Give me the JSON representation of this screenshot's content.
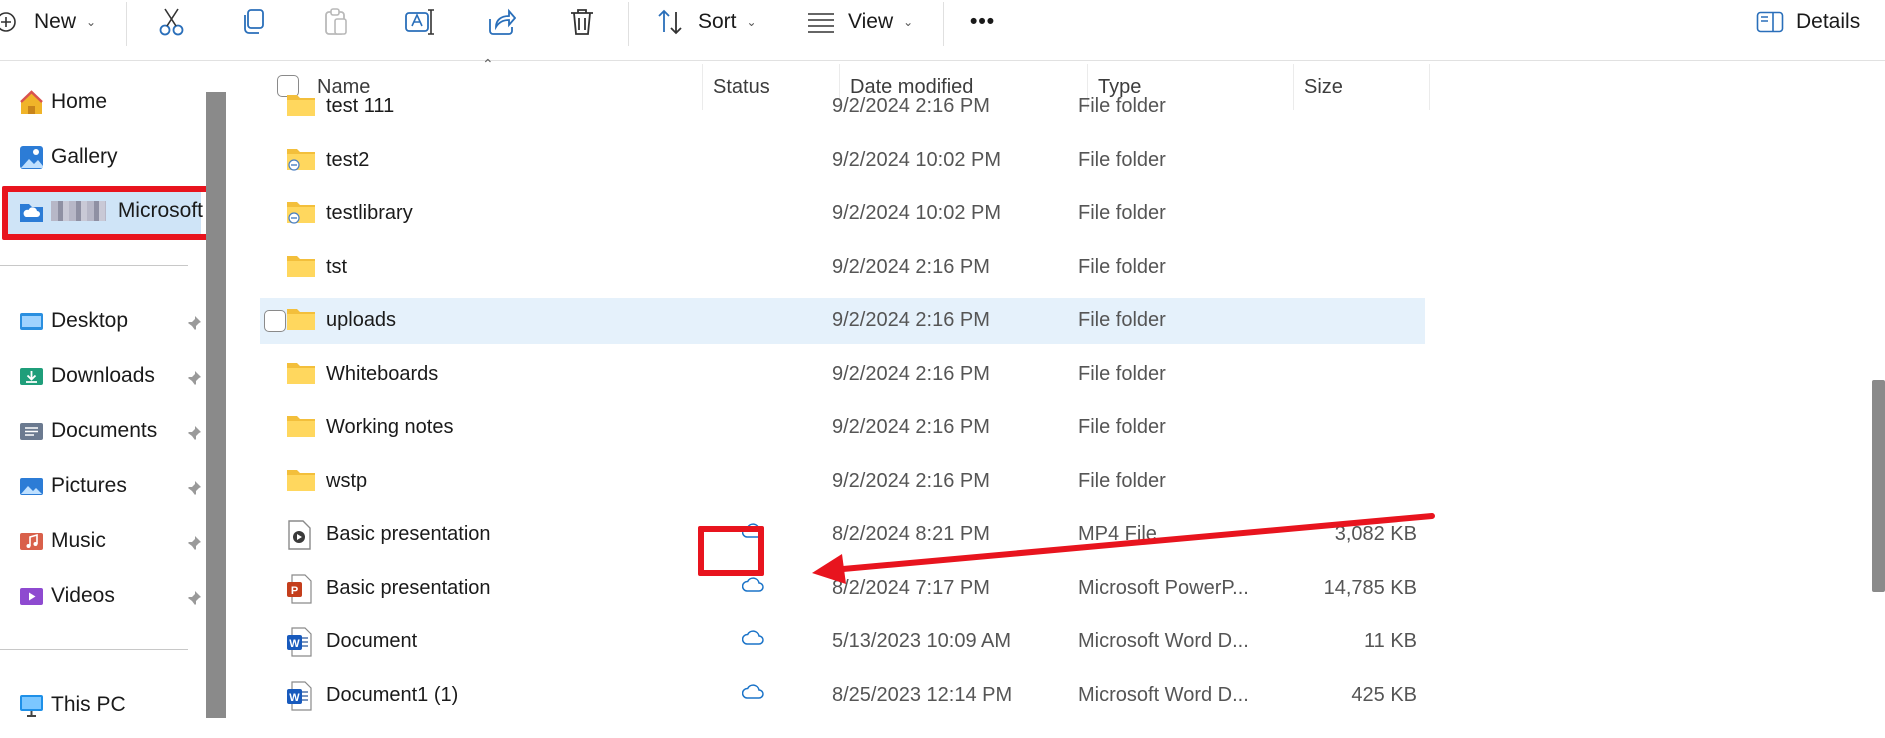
{
  "toolbar": {
    "new_label": "New",
    "sort_label": "Sort",
    "view_label": "View",
    "details_label": "Details",
    "more_label": "•••"
  },
  "sidebar": {
    "home": "Home",
    "gallery": "Gallery",
    "onedrive": "Microsoft",
    "desktop": "Desktop",
    "downloads": "Downloads",
    "documents": "Documents",
    "pictures": "Pictures",
    "music": "Music",
    "videos": "Videos",
    "this_pc": "This PC"
  },
  "columns": {
    "name": "Name",
    "status": "Status",
    "date": "Date modified",
    "type": "Type",
    "size": "Size"
  },
  "files": [
    {
      "name": "test 111",
      "date": "9/2/2024 2:16 PM",
      "type": "File folder",
      "size": "",
      "icon": "folder-icon",
      "status": ""
    },
    {
      "name": "test2",
      "date": "9/2/2024 10:02 PM",
      "type": "File folder",
      "size": "",
      "icon": "shared-folder-icon",
      "status": ""
    },
    {
      "name": "testlibrary",
      "date": "9/2/2024 10:02 PM",
      "type": "File folder",
      "size": "",
      "icon": "shared-folder-icon",
      "status": ""
    },
    {
      "name": "tst",
      "date": "9/2/2024 2:16 PM",
      "type": "File folder",
      "size": "",
      "icon": "folder-icon",
      "status": ""
    },
    {
      "name": "uploads",
      "date": "9/2/2024 2:16 PM",
      "type": "File folder",
      "size": "",
      "icon": "folder-icon",
      "status": ""
    },
    {
      "name": "Whiteboards",
      "date": "9/2/2024 2:16 PM",
      "type": "File folder",
      "size": "",
      "icon": "folder-icon",
      "status": ""
    },
    {
      "name": "Working notes",
      "date": "9/2/2024 2:16 PM",
      "type": "File folder",
      "size": "",
      "icon": "folder-icon",
      "status": ""
    },
    {
      "name": "wstp",
      "date": "9/2/2024 2:16 PM",
      "type": "File folder",
      "size": "",
      "icon": "folder-icon",
      "status": ""
    },
    {
      "name": "Basic presentation",
      "date": "8/2/2024 8:21 PM",
      "type": "MP4 File",
      "size": "3,082 KB",
      "icon": "video-file-icon",
      "status": "cloud"
    },
    {
      "name": "Basic presentation",
      "date": "8/2/2024 7:17 PM",
      "type": "Microsoft PowerP...",
      "size": "14,785 KB",
      "icon": "powerpoint-file-icon",
      "status": "cloud"
    },
    {
      "name": "Document",
      "date": "5/13/2023 10:09 AM",
      "type": "Microsoft Word D...",
      "size": "11 KB",
      "icon": "word-file-icon",
      "status": "cloud"
    },
    {
      "name": "Document1 (1)",
      "date": "8/25/2023 12:14 PM",
      "type": "Microsoft Word D...",
      "size": "425 KB",
      "icon": "word-file-icon",
      "status": "cloud"
    }
  ],
  "colors": {
    "accent": "#0067c0",
    "annotation_red": "#e8141e",
    "selection": "#cfe4f7",
    "hover_row": "#e5f1fb"
  }
}
